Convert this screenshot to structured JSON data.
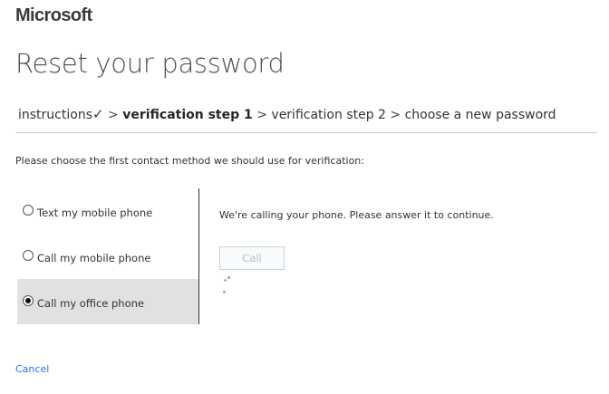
{
  "brand": {
    "logo_text": "Microsoft"
  },
  "page": {
    "title": "Reset your password"
  },
  "breadcrumb": {
    "step1": "instructions",
    "step1_check": "✓",
    "separator": ">",
    "step2": "verification step 1",
    "step3": "verification step 2",
    "step4": "choose a new password"
  },
  "instructions": "Please choose the first contact method we should use for verification:",
  "options": [
    {
      "label": "Text my mobile phone",
      "selected": false
    },
    {
      "label": "Call my mobile phone",
      "selected": false
    },
    {
      "label": "Call my office phone",
      "selected": true
    }
  ],
  "status": {
    "message": "We're calling your phone. Please answer it to continue.",
    "loading_icon": "spinner-icon"
  },
  "actions": {
    "call_label": "Call",
    "cancel_label": "Cancel"
  },
  "colors": {
    "link": "#2672ec",
    "selected_option_bg": "#e1e1e1"
  }
}
